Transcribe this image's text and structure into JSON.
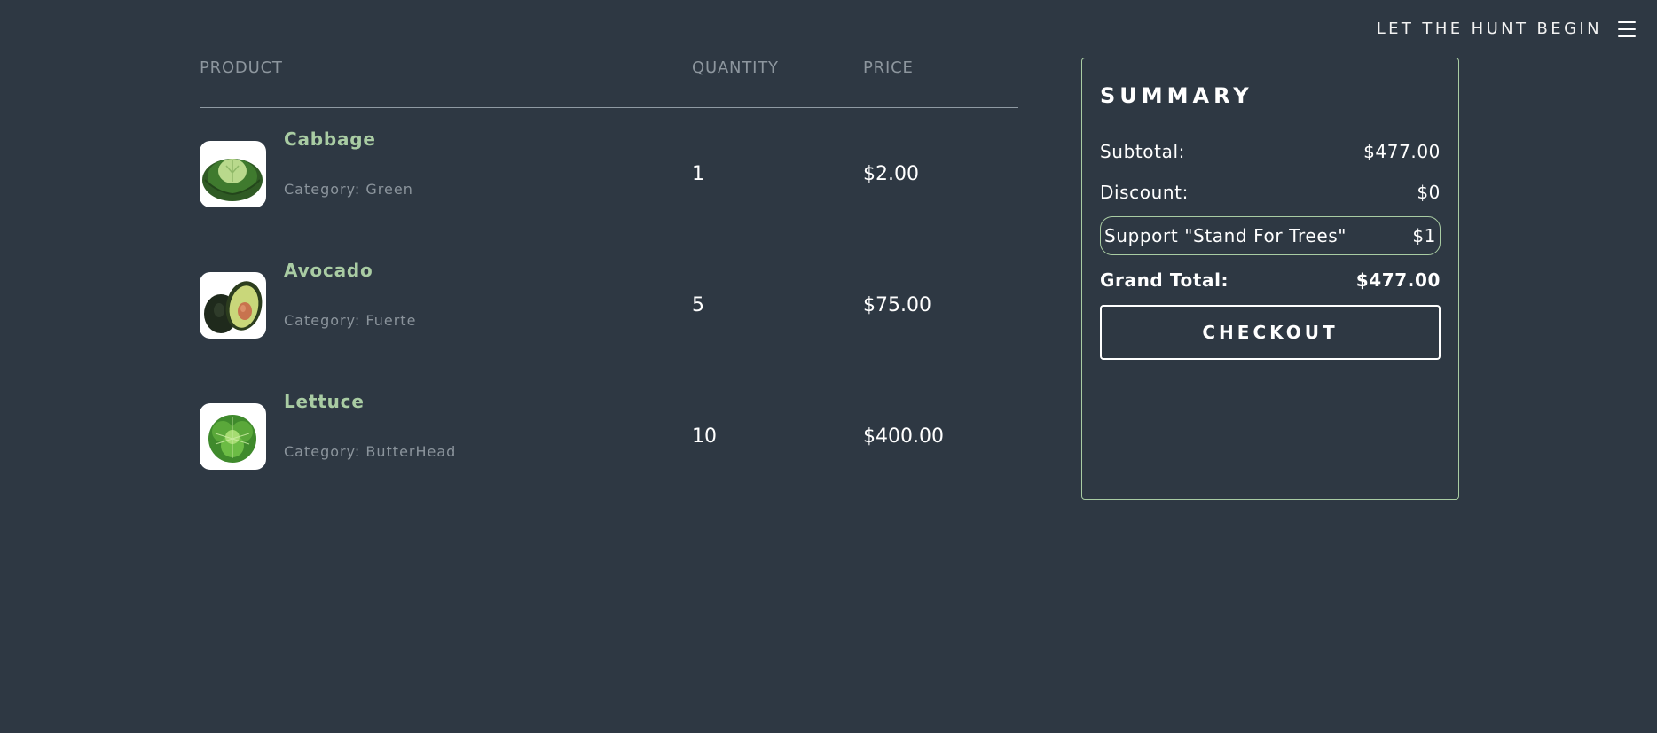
{
  "header": {
    "label": "LET THE HUNT BEGIN",
    "menu_icon": "hamburger-icon"
  },
  "cart": {
    "columns": {
      "product": "PRODUCT",
      "quantity": "QUANTITY",
      "price": "PRICE"
    },
    "items": [
      {
        "name": "Cabbage",
        "category": "Category: Green",
        "quantity": "1",
        "price": "$2.00",
        "image": "cabbage"
      },
      {
        "name": "Avocado",
        "category": "Category: Fuerte",
        "quantity": "5",
        "price": "$75.00",
        "image": "avocado"
      },
      {
        "name": "Lettuce",
        "category": "Category: ButterHead",
        "quantity": "10",
        "price": "$400.00",
        "image": "lettuce"
      }
    ]
  },
  "summary": {
    "title": "SUMMARY",
    "subtotal_label": "Subtotal:",
    "subtotal_value": "$477.00",
    "discount_label": "Discount:",
    "discount_value": "$0",
    "support_label": "Support \"Stand For Trees\"",
    "support_value": "$1",
    "grand_total_label": "Grand Total:",
    "grand_total_value": "$477.00",
    "checkout_label": "CHECKOUT"
  },
  "colors": {
    "background": "#2e3843",
    "accent_green": "#a9cca3",
    "muted_text": "#8d969e"
  }
}
